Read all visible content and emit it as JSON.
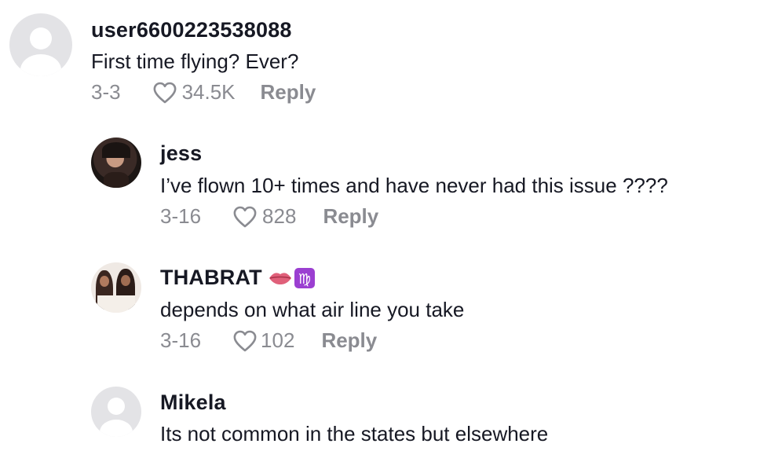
{
  "comments": [
    {
      "username": "user6600223538088",
      "text": "First time flying? Ever?",
      "date": "3-3",
      "likes": "34.5K",
      "reply": "Reply"
    },
    {
      "username": "jess",
      "text": "I’ve flown 10+ times and have never had this issue ????",
      "date": "3-16",
      "likes": "828",
      "reply": "Reply"
    },
    {
      "username": "THABRAT",
      "emoji": [
        "lips-emoji",
        "virgo-emoji"
      ],
      "text": "depends on what air line you take",
      "date": "3-16",
      "likes": "102",
      "reply": "Reply"
    },
    {
      "username": "Mikela",
      "text": "Its not common in the states but elsewhere"
    }
  ],
  "colors": {
    "username": "#161823",
    "meta": "#8a8b91",
    "default_avatar_bg": "#e3e3e6",
    "virgo_badge": "#9b3fd1",
    "lips": "#e0607a"
  }
}
